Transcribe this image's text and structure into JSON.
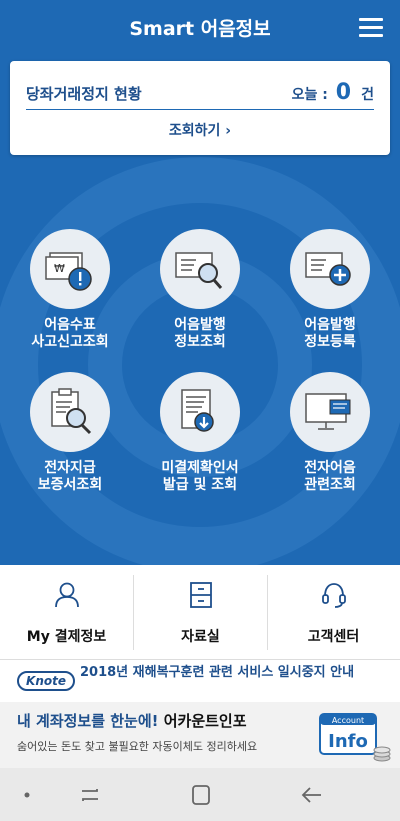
{
  "header": {
    "title": "Smart 어음정보",
    "menu_icon": "hamburger-icon"
  },
  "status_card": {
    "title": "당좌거래정지 현황",
    "today_label": "오늘 :",
    "today_count": "0",
    "today_unit": "건",
    "query_button": "조회하기  ›"
  },
  "menu": [
    {
      "label_line1": "어음수표",
      "label_line2": "사고신고조회",
      "icon": "check-warning-icon"
    },
    {
      "label_line1": "어음발행",
      "label_line2": "정보조회",
      "icon": "document-search-icon"
    },
    {
      "label_line1": "어음발행",
      "label_line2": "정보등록",
      "icon": "document-add-icon"
    },
    {
      "label_line1": "전자지급",
      "label_line2": "보증서조회",
      "icon": "clipboard-search-icon"
    },
    {
      "label_line1": "미결제확인서",
      "label_line2": "발급 및 조회",
      "icon": "document-download-icon"
    },
    {
      "label_line1": "전자어음",
      "label_line2": "관련조회",
      "icon": "monitor-document-icon"
    }
  ],
  "bottom_nav": [
    {
      "label": "My 결제정보",
      "icon": "user-icon"
    },
    {
      "label": "자료실",
      "icon": "cabinet-icon"
    },
    {
      "label": "고객센터",
      "icon": "headset-icon"
    }
  ],
  "notice": {
    "badge": "Knote",
    "text": "2018년 재해복구훈련 관련 서비스 일시중지 안내"
  },
  "ad": {
    "line1_prefix": "내 계좌정보를 한눈에!",
    "line1_brand": "어카운트인포",
    "line2": "숨어있는 돈도 찾고 불필요한 자동이체도 정리하세요",
    "logo_small": "Account",
    "logo_big": "Info"
  },
  "colors": {
    "primary": "#1e69b4",
    "dark_blue": "#1e4f8c",
    "circle_bg": "#e9eef3"
  }
}
